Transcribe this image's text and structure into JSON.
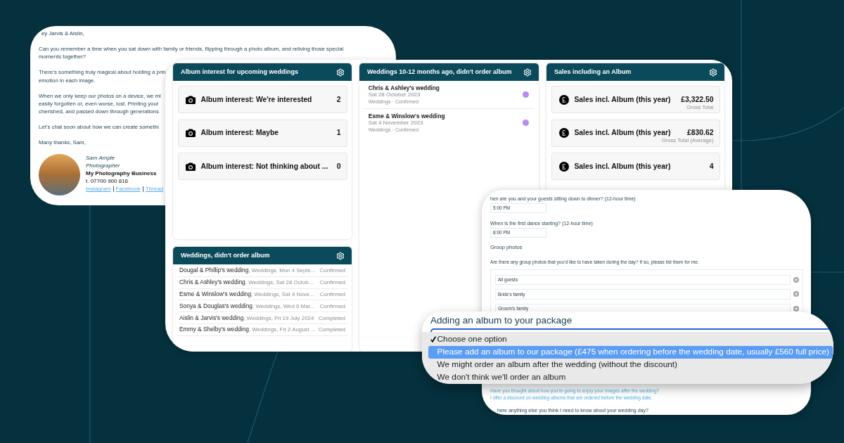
{
  "email": {
    "greeting": "ey Jarvis & Aislin,",
    "paragraphs": [
      [
        "Can you remember a time when you sat down with family or friends, flipping through a photo album, and reliving those special",
        "moments together?"
      ],
      [
        "There’s something truly magical about holding a prin",
        "emotion in each image."
      ],
      [
        "When we only keep our photos on a device, we mi",
        "easily forgotten or, even worse, lost. Printing your",
        "cherished, and passed down through generations"
      ],
      [
        "Let’s chat soon about how we can create somethi"
      ],
      [
        "Many thanks, Sam,"
      ]
    ],
    "signature": {
      "name": "Sam Ample",
      "role": "Photographer",
      "business": "My Photography Business",
      "phone": "t. 07700 900 816",
      "links": [
        "Instagram",
        "Facebook",
        "Thread"
      ]
    }
  },
  "dashboard": {
    "columns": [
      {
        "panels": [
          {
            "kind": "interest",
            "title": "Album interest for upcoming weddings",
            "tiles": [
              {
                "label": "Album interest: We're interested",
                "value": "2"
              },
              {
                "label": "Album interest: Maybe",
                "value": "1"
              },
              {
                "label": "Album interest: Not thinking about ...",
                "value": "0"
              }
            ]
          },
          {
            "kind": "table",
            "title": "Weddings, didn't order album",
            "rows": [
              {
                "name": "Dougal & Phillip's wedding",
                "details": ", Weddings, Mon 4 Septe...",
                "status": "Confirmed"
              },
              {
                "name": "Chris & Ashley's wedding",
                "details": ", Weddings, Sat 28 Octob...",
                "status": "Confirmed"
              },
              {
                "name": "Esme & Winslow's wedding",
                "details": ", Weddings, Sat 4 Nove...",
                "status": "Confirmed"
              },
              {
                "name": "Sonya & Douglas's wedding",
                "details": ", Weddings, Wed 6 Mar...",
                "status": "Confirmed"
              },
              {
                "name": "Aislin & Jarvis's wedding",
                "details": ", Weddings, Fri 19 July 2024",
                "status": "Completed"
              },
              {
                "name": "Emmy & Shelby's wedding",
                "details": ", Weddings, Fri 2 August ...",
                "status": "Completed"
              }
            ]
          }
        ]
      },
      {
        "panels": [
          {
            "kind": "list",
            "title": "Weddings 10-12 months ago, didn't order album",
            "items": [
              {
                "name": "Chris & Ashley's wedding",
                "date": "Sat 28 October 2023",
                "meta": "Weddings · Confirmed",
                "color": "#b68cf2"
              },
              {
                "name": "Esme & Winslow's wedding",
                "date": "Sat 4 November 2023",
                "meta": "Weddings · Confirmed",
                "color": "#b68cf2"
              }
            ]
          }
        ]
      },
      {
        "panels": [
          {
            "kind": "sales",
            "title": "Sales including an Album",
            "tiles": [
              {
                "label": "Sales incl. Album (this year)",
                "value": "£3,322.50",
                "caption": "Gross Total"
              },
              {
                "label": "Sales incl. Album (this year)",
                "value": "£830.62",
                "caption": "Gross Total (Average)"
              },
              {
                "label": "Sales incl. Album (this year)",
                "value": "4"
              }
            ]
          }
        ]
      }
    ]
  },
  "form": {
    "fields": [
      {
        "label": "hen are you and your guests sitting down to dinner? (12-hour time)",
        "value": "5:00 PM"
      },
      {
        "label": "When is the first dance starting? (12-hour time)",
        "value": "8:00 PM"
      }
    ],
    "group_photos": {
      "heading": "Group photos",
      "prompt": "Are there any group photos that you'd like to have taken during the day? If so, please list them for me.",
      "items": [
        "All guests",
        "Bride's family",
        "Groom's family"
      ]
    },
    "album_help": [
      "Have you thought about how you're going to enjoy your images after the wedding?",
      "I offer a discount on wedding albums that are ordered before the wedding date."
    ],
    "next_question": "here anything else you think I need to know about your wedding day?"
  },
  "dropdown": {
    "label": "Adding an album to your package",
    "options": [
      {
        "label": "Choose one option",
        "selected": true,
        "highlighted": false
      },
      {
        "label": "Please add an album to our package (£475 when ordering before the wedding date, usually £560 full price)",
        "selected": false,
        "highlighted": true
      },
      {
        "label": "We might order an album after the wedding (without the discount)",
        "selected": false,
        "highlighted": false
      },
      {
        "label": "We don't think we'll order an album",
        "selected": false,
        "highlighted": false
      }
    ]
  }
}
